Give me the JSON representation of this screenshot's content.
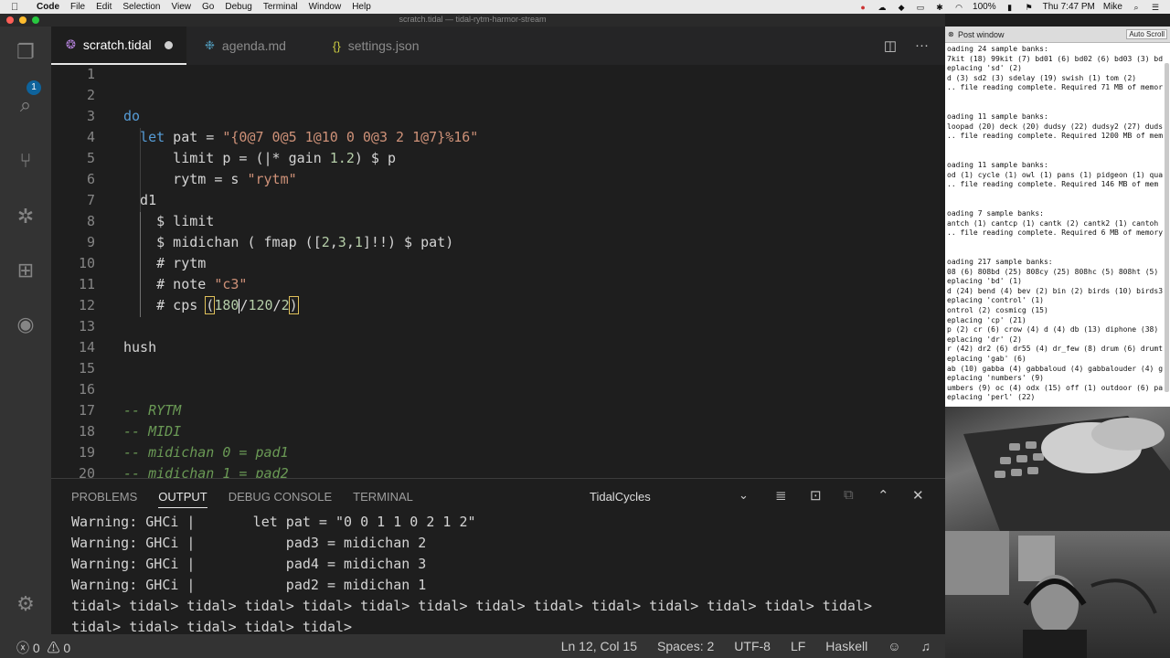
{
  "menubar": {
    "apple": "",
    "app": "Code",
    "items": [
      "File",
      "Edit",
      "Selection",
      "View",
      "Go",
      "Debug",
      "Terminal",
      "Window",
      "Help"
    ],
    "battery": "100%",
    "clock": "Thu 7:47 PM",
    "user": "Mike"
  },
  "window": {
    "title": "scratch.tidal — tidal-rytm-harmor-stream"
  },
  "activity": {
    "scm_badge": "1"
  },
  "tabs": [
    {
      "label": "scratch.tidal",
      "icon": "tidal-icon",
      "glyph": "❂",
      "icon_color": "#b180d7",
      "dirty": true
    },
    {
      "label": "agenda.md",
      "icon": "markdown-icon",
      "glyph": "❉",
      "icon_color": "#519aba"
    },
    {
      "label": "settings.json",
      "icon": "json-icon",
      "glyph": "{}",
      "icon_color": "#cbcb41"
    }
  ],
  "editor": {
    "lines": [
      {
        "n": "1",
        "indent": 0,
        "tokens": []
      },
      {
        "n": "2",
        "indent": 0,
        "tokens": []
      },
      {
        "n": "3",
        "indent": 0,
        "tokens": [
          {
            "t": "do",
            "c": "kw"
          }
        ]
      },
      {
        "n": "4",
        "indent": 2,
        "tokens": [
          {
            "t": "let",
            "c": "kw"
          },
          {
            "t": " pat = ",
            "c": "op"
          },
          {
            "t": "\"{0@7 0@5 1@10 0 0@3 2 1@7}%16\"",
            "c": "str"
          }
        ]
      },
      {
        "n": "5",
        "indent": 6,
        "tokens": [
          {
            "t": "limit p = (|* gain ",
            "c": "op"
          },
          {
            "t": "1.2",
            "c": "num"
          },
          {
            "t": ") $ p",
            "c": "op"
          }
        ]
      },
      {
        "n": "6",
        "indent": 6,
        "tokens": [
          {
            "t": "rytm = s ",
            "c": "op"
          },
          {
            "t": "\"rytm\"",
            "c": "str"
          }
        ]
      },
      {
        "n": "7",
        "indent": 2,
        "tokens": [
          {
            "t": "d1",
            "c": "op"
          }
        ]
      },
      {
        "n": "8",
        "indent": 4,
        "tokens": [
          {
            "t": "$ limit",
            "c": "op"
          }
        ]
      },
      {
        "n": "9",
        "indent": 4,
        "tokens": [
          {
            "t": "$ midichan ( fmap ([",
            "c": "op"
          },
          {
            "t": "2",
            "c": "num"
          },
          {
            "t": ",",
            "c": "op"
          },
          {
            "t": "3",
            "c": "num"
          },
          {
            "t": ",",
            "c": "op"
          },
          {
            "t": "1",
            "c": "num"
          },
          {
            "t": "]!!) $ pat)",
            "c": "op"
          }
        ]
      },
      {
        "n": "10",
        "indent": 4,
        "tokens": [
          {
            "t": "# rytm",
            "c": "op"
          }
        ]
      },
      {
        "n": "11",
        "indent": 4,
        "tokens": [
          {
            "t": "# note ",
            "c": "op"
          },
          {
            "t": "\"c3\"",
            "c": "str"
          }
        ]
      },
      {
        "n": "12",
        "indent": 4,
        "tokens": [
          {
            "t": "# cps ",
            "c": "op"
          },
          {
            "t": "(",
            "c": "op brk"
          },
          {
            "t": "180",
            "c": "num"
          },
          {
            "t": "|",
            "c": "cursor"
          },
          {
            "t": "/",
            "c": "op"
          },
          {
            "t": "120",
            "c": "num"
          },
          {
            "t": "/",
            "c": "op"
          },
          {
            "t": "2",
            "c": "num"
          },
          {
            "t": ")",
            "c": "op brk"
          }
        ]
      },
      {
        "n": "13",
        "indent": 0,
        "tokens": []
      },
      {
        "n": "14",
        "indent": 0,
        "tokens": [
          {
            "t": "hush",
            "c": "op"
          }
        ]
      },
      {
        "n": "15",
        "indent": 0,
        "tokens": []
      },
      {
        "n": "16",
        "indent": 0,
        "tokens": []
      },
      {
        "n": "17",
        "indent": 0,
        "tokens": [
          {
            "t": "-- RYTM",
            "c": "cmt"
          }
        ]
      },
      {
        "n": "18",
        "indent": 0,
        "tokens": [
          {
            "t": "-- MIDI",
            "c": "cmt"
          }
        ]
      },
      {
        "n": "19",
        "indent": 0,
        "tokens": [
          {
            "t": "-- midichan 0 = pad1",
            "c": "cmt"
          }
        ]
      },
      {
        "n": "20",
        "indent": 0,
        "tokens": [
          {
            "t": "-- midichan 1 = pad2",
            "c": "cmt"
          }
        ]
      }
    ]
  },
  "panel": {
    "tabs": [
      "PROBLEMS",
      "OUTPUT",
      "DEBUG CONSOLE",
      "TERMINAL"
    ],
    "active_tab": "OUTPUT",
    "channel": "TidalCycles",
    "output": [
      "Warning: GHCi |       let pat = \"0 0 1 1 0 2 1 2\"",
      "Warning: GHCi |           pad3 = midichan 2",
      "Warning: GHCi |           pad4 = midichan 3",
      "Warning: GHCi |           pad2 = midichan 1",
      "tidal> tidal> tidal> tidal> tidal> tidal> tidal> tidal> tidal> tidal> tidal> tidal> tidal> tidal>",
      "tidal> tidal> tidal> tidal> tidal>"
    ]
  },
  "status": {
    "errors": "0",
    "warnings": "0",
    "position": "Ln 12, Col 15",
    "spaces": "Spaces: 2",
    "encoding": "UTF-8",
    "eol": "LF",
    "language": "Haskell"
  },
  "post_window": {
    "title": "Post window",
    "autoscroll": "Auto Scroll",
    "lines": [
      "oading 24 sample banks:",
      "7kit (18) 99kit (7) bd01 (6) bd02 (6) bd03 (3) bd",
      "eplacing 'sd' (2)",
      "d (3) sd2 (3) sdelay (19) swish (1) tom (2)",
      ".. file reading complete. Required 71 MB of memor",
      "",
      "",
      "oading 11 sample banks:",
      "loopad (20) deck (20) dudsy (22) dudsy2 (27) duds",
      ".. file reading complete. Required 1200 MB of mem",
      "",
      "",
      "oading 11 sample banks:",
      "od (1) cycle (1) owl (1) pans (1) pidgeon (1) qua",
      ".. file reading complete. Required 146 MB of mem",
      "",
      "",
      "oading 7 sample banks:",
      "antch (1) cantcp (1) cantk (2) cantk2 (1) cantoh",
      ".. file reading complete. Required 6 MB of memory",
      "",
      "",
      "oading 217 sample banks:",
      "08 (6) 808bd (25) 808cy (25) 808hc (5) 808ht (5)",
      "eplacing 'bd' (1)",
      "d (24) bend (4) bev (2) bin (2) birds (10) birds3",
      "eplacing 'control' (1)",
      "ontrol (2) cosmicg (15)",
      "eplacing 'cp' (21)",
      "p (2) cr (6) crow (4) d (4) db (13) diphone (38)",
      "eplacing 'dr' (2)",
      "r (42) dr2 (6) dr55 (4) dr_few (8) drum (6) drumt",
      "eplacing 'gab' (6)",
      "ab (10) gabba (4) gabbaloud (4) gabbalouder (4) g",
      "eplacing 'numbers' (9)",
      "umbers (9) oc (4) odx (15) off (1) outdoor (6) pa",
      "eplacing 'perl' (22)"
    ]
  }
}
